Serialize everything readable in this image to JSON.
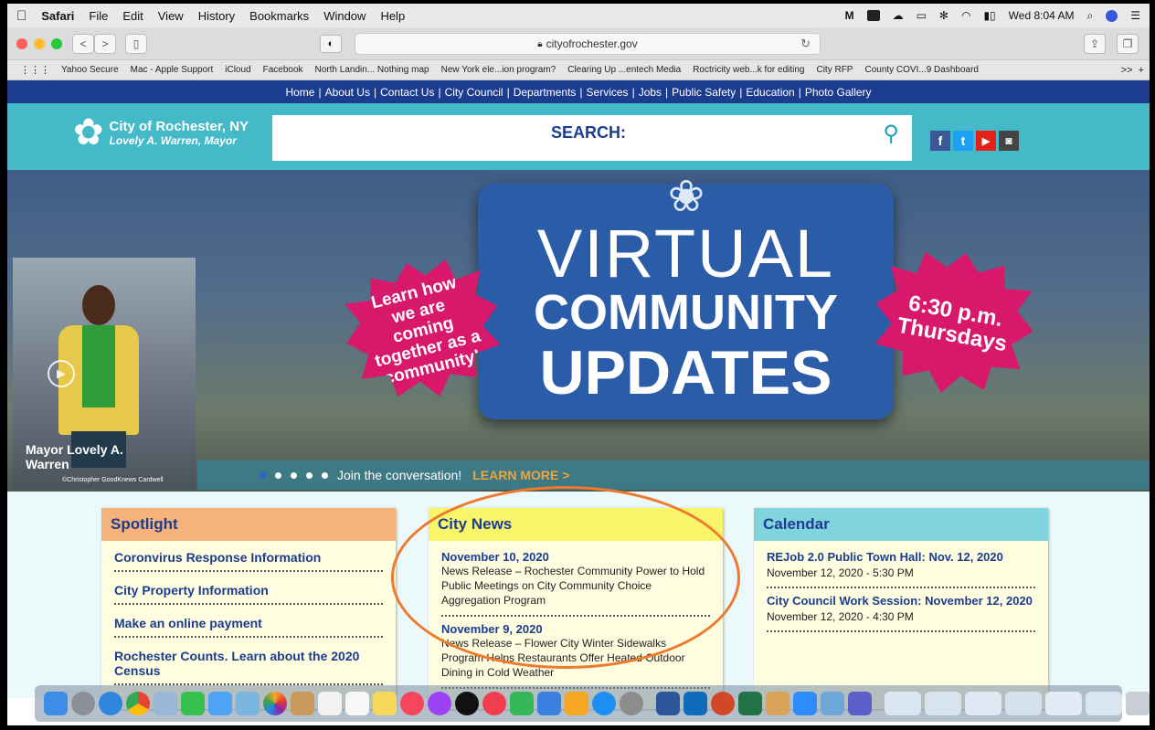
{
  "menubar": {
    "apple": "",
    "items": [
      "Safari",
      "File",
      "Edit",
      "View",
      "History",
      "Bookmarks",
      "Window",
      "Help"
    ],
    "clock": "Wed 8:04 AM"
  },
  "toolbar": {
    "url": "cityofrochester.gov"
  },
  "bookmarks": {
    "items": [
      "Yahoo Secure",
      "Mac - Apple Support",
      "iCloud",
      "Facebook",
      "North Landin... Nothing map",
      "New York ele...ion program?",
      "Clearing Up ...entech Media",
      "Roctricity web...k for editing",
      "City RFP",
      "County COVI...9 Dashboard"
    ],
    "more": ">>"
  },
  "sitenav": {
    "items": [
      "Home",
      "About Us",
      "Contact Us",
      "City Council",
      "Departments",
      "Services",
      "Jobs",
      "Public Safety",
      "Education",
      "Photo Gallery"
    ]
  },
  "header": {
    "logo_title": "City of Rochester, NY",
    "logo_subtitle": "Lovely A. Warren, Mayor",
    "search_label": "SEARCH:",
    "social": [
      "f",
      "t",
      "▶",
      "◙"
    ]
  },
  "hero": {
    "mayor_name": "Mayor Lovely A. Warren",
    "credit": "©Christopher GoodKnews Cardwell",
    "title_line1": "VIRTUAL",
    "title_line2": "COMMUNITY",
    "title_line3": "UPDATES",
    "burst_left": "Learn how we are coming together as a community!",
    "burst_right": "6:30 p.m. Thursdays",
    "bar_text": "Join the conversation!",
    "bar_link": "LEARN MORE >"
  },
  "spotlight": {
    "title": "Spotlight",
    "links": [
      "Coronvirus Response Information",
      "City Property Information",
      "Make an online payment",
      "Rochester Counts. Learn about the 2020 Census"
    ]
  },
  "citynews": {
    "title": "City News",
    "items": [
      {
        "date": "November 10, 2020",
        "text": "News Release – Rochester Community Power to Hold Public Meetings on City Community Choice Aggregation Program"
      },
      {
        "date": "November 9, 2020",
        "text": "News Release – Flower City Winter Sidewalks Program Helps Restaurants Offer Heated Outdoor Dining in Cold Weather"
      }
    ]
  },
  "calendar": {
    "title": "Calendar",
    "items": [
      {
        "title": "REJob 2.0 Public Town Hall: Nov. 12, 2020",
        "time": "November 12, 2020 - 5:30 PM"
      },
      {
        "title": "City Council Work Session: November 12, 2020",
        "time": "November 12, 2020 - 4:30 PM"
      }
    ]
  },
  "colors": {
    "navy": "#1c3d8f",
    "teal": "#44b9c7",
    "pink": "#d8186b",
    "orange": "#ee7a2d"
  }
}
